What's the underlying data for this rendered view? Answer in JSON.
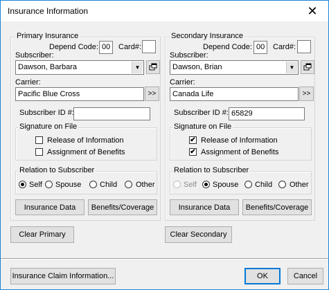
{
  "window": {
    "title": "Insurance Information",
    "close_glyph": "✕"
  },
  "primary": {
    "group_label": "Primary Insurance",
    "depend_code_label": "Depend Code:",
    "depend_code_value": "00",
    "card_label": "Card#:",
    "card_value": "",
    "subscriber_label": "Subscriber:",
    "subscriber_value": "Dawson, Barbara",
    "carrier_label": "Carrier:",
    "carrier_value": "Pacific Blue Cross",
    "carrier_btn": ">>",
    "subscriber_id_label": "Subscriber ID #:",
    "subscriber_id_value": "",
    "signature_label": "Signature on File",
    "release_label": "Release of Information",
    "release_checked": false,
    "assignment_label": "Assignment of Benefits",
    "assignment_checked": false,
    "relation_label": "Relation to Subscriber",
    "relation_options": [
      "Self",
      "Spouse",
      "Child",
      "Other"
    ],
    "relation_selected": "Self",
    "insurance_data_btn": "Insurance Data",
    "benefits_btn": "Benefits/Coverage",
    "clear_btn": "Clear Primary"
  },
  "secondary": {
    "group_label": "Secondary Insurance",
    "depend_code_label": "Depend Code:",
    "depend_code_value": "00",
    "card_label": "Card#:",
    "card_value": "",
    "subscriber_label": "Subscriber:",
    "subscriber_value": "Dawson, Brian",
    "carrier_label": "Carrier:",
    "carrier_value": "Canada Life",
    "carrier_btn": ">>",
    "subscriber_id_label": "Subscriber ID #:",
    "subscriber_id_value": "65829",
    "signature_label": "Signature on File",
    "release_label": "Release of Information",
    "release_checked": true,
    "assignment_label": "Assignment of Benefits",
    "assignment_checked": true,
    "relation_label": "Relation to Subscriber",
    "relation_options": [
      "Self",
      "Spouse",
      "Child",
      "Other"
    ],
    "relation_selected": "Spouse",
    "self_disabled": true,
    "insurance_data_btn": "Insurance Data",
    "benefits_btn": "Benefits/Coverage",
    "clear_btn": "Clear Secondary"
  },
  "footer": {
    "claim_info_btn": "Insurance Claim Information...",
    "ok_btn": "OK",
    "cancel_btn": "Cancel"
  },
  "check_glyph": "✔"
}
